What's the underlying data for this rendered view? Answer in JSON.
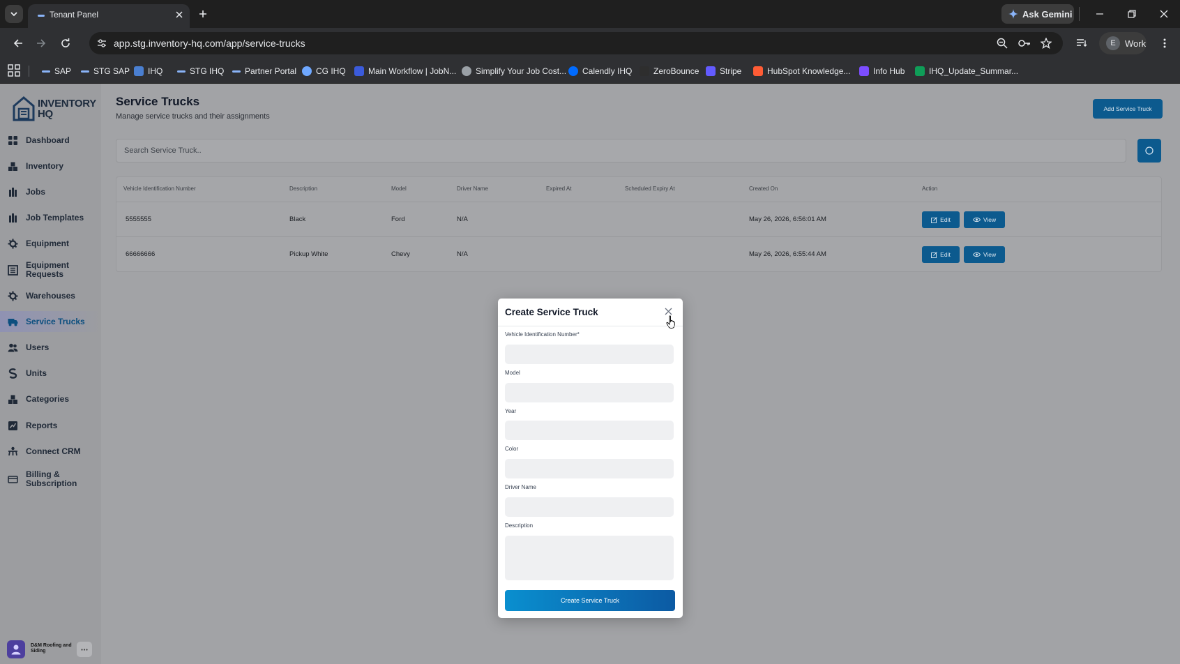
{
  "browser": {
    "tab_title": "Tenant Panel",
    "ask_gemini": "Ask Gemini",
    "url": "app.stg.inventory-hq.com/app/service-trucks",
    "profile_letter": "E",
    "profile_label": "Work",
    "bookmarks": [
      {
        "label": "SAP",
        "icon": "dash",
        "color": "#8ab4f8"
      },
      {
        "label": "STG SAP",
        "icon": "dash",
        "color": "#8ab4f8"
      },
      {
        "label": "IHQ",
        "icon": "house-logo",
        "color": "#4a7fd1"
      },
      {
        "label": "STG IHQ",
        "icon": "dash",
        "color": "#8ab4f8"
      },
      {
        "label": "Partner Portal",
        "icon": "dash",
        "color": "#8ab4f8"
      },
      {
        "label": "CG IHQ",
        "icon": "globe",
        "color": "#6fa8ff"
      },
      {
        "label": "Main Workflow | JobN...",
        "icon": "logo",
        "color": "#3b5bdb"
      },
      {
        "label": "Simplify Your Job Cost...",
        "icon": "globe",
        "color": "#9aa0a6"
      },
      {
        "label": "Calendly IHQ",
        "icon": "circle",
        "color": "#006bff"
      },
      {
        "label": "ZeroBounce",
        "icon": "logo",
        "color": "#2e2e2e"
      },
      {
        "label": "Stripe",
        "icon": "logo",
        "color": "#635bff"
      },
      {
        "label": "HubSpot Knowledge...",
        "icon": "logo",
        "color": "#ff5c35"
      },
      {
        "label": "Info Hub",
        "icon": "logo",
        "color": "#7c4dff"
      },
      {
        "label": "IHQ_Update_Summar...",
        "icon": "logo",
        "color": "#0f9d58"
      }
    ]
  },
  "sidebar": {
    "logo_line1": "INVENTORY",
    "logo_line2": "HQ",
    "items": [
      {
        "label": "Dashboard",
        "icon": "dashboard-grid-icon",
        "active": false
      },
      {
        "label": "Inventory",
        "icon": "inventory-icon",
        "active": false
      },
      {
        "label": "Jobs",
        "icon": "jobs-icon",
        "active": false
      },
      {
        "label": "Job Templates",
        "icon": "job-templates-icon",
        "active": false
      },
      {
        "label": "Equipment",
        "icon": "equipment-gear-icon",
        "active": false
      },
      {
        "label": "Equipment Requests",
        "icon": "equipment-requests-icon",
        "active": false
      },
      {
        "label": "Warehouses",
        "icon": "warehouses-icon",
        "active": false
      },
      {
        "label": "Service Trucks",
        "icon": "truck-icon",
        "active": true
      },
      {
        "label": "Users",
        "icon": "users-icon",
        "active": false
      },
      {
        "label": "Units",
        "icon": "units-icon",
        "active": false
      },
      {
        "label": "Categories",
        "icon": "categories-icon",
        "active": false
      },
      {
        "label": "Reports",
        "icon": "reports-icon",
        "active": false
      },
      {
        "label": "Connect CRM",
        "icon": "connect-crm-icon",
        "active": false
      },
      {
        "label": "Billing &\nSubscription",
        "icon": "billing-card-icon",
        "active": false
      }
    ],
    "user_name": "D&M Roofing and Siding"
  },
  "main": {
    "title": "Service Trucks",
    "subtitle": "Manage service trucks and their assignments",
    "add_button": "Add Service Truck",
    "search_placeholder": "Search Service Truck..",
    "table": {
      "columns": [
        "Vehicle Identification Number",
        "Description",
        "Model",
        "Driver Name",
        "Expired At",
        "Scheduled Expiry At",
        "Created On",
        "Action"
      ],
      "rows": [
        {
          "vin": "5555555",
          "description": "Black",
          "model": "Ford",
          "driver": "N/A",
          "expired_at": "",
          "scheduled_expiry": "",
          "created_on": "May 26, 2026, 6:56:01 AM"
        },
        {
          "vin": "66666666",
          "description": "Pickup White",
          "model": "Chevy",
          "driver": "N/A",
          "expired_at": "",
          "scheduled_expiry": "",
          "created_on": "May 26, 2026, 6:55:44 AM"
        }
      ],
      "edit_label": "Edit",
      "view_label": "View"
    }
  },
  "modal": {
    "title": "Create Service Truck",
    "fields": {
      "vin_label": "Vehicle Identification Number*",
      "model_label": "Model",
      "year_label": "Year",
      "color_label": "Color",
      "driver_label": "Driver Name",
      "description_label": "Description"
    },
    "submit_label": "Create Service Truck"
  },
  "colors": {
    "accent": "#0c5a8e",
    "submit_gradient_start": "#0a8fcf",
    "submit_gradient_end": "#0c5aa3",
    "overlay_page": "#a2a3a6"
  }
}
